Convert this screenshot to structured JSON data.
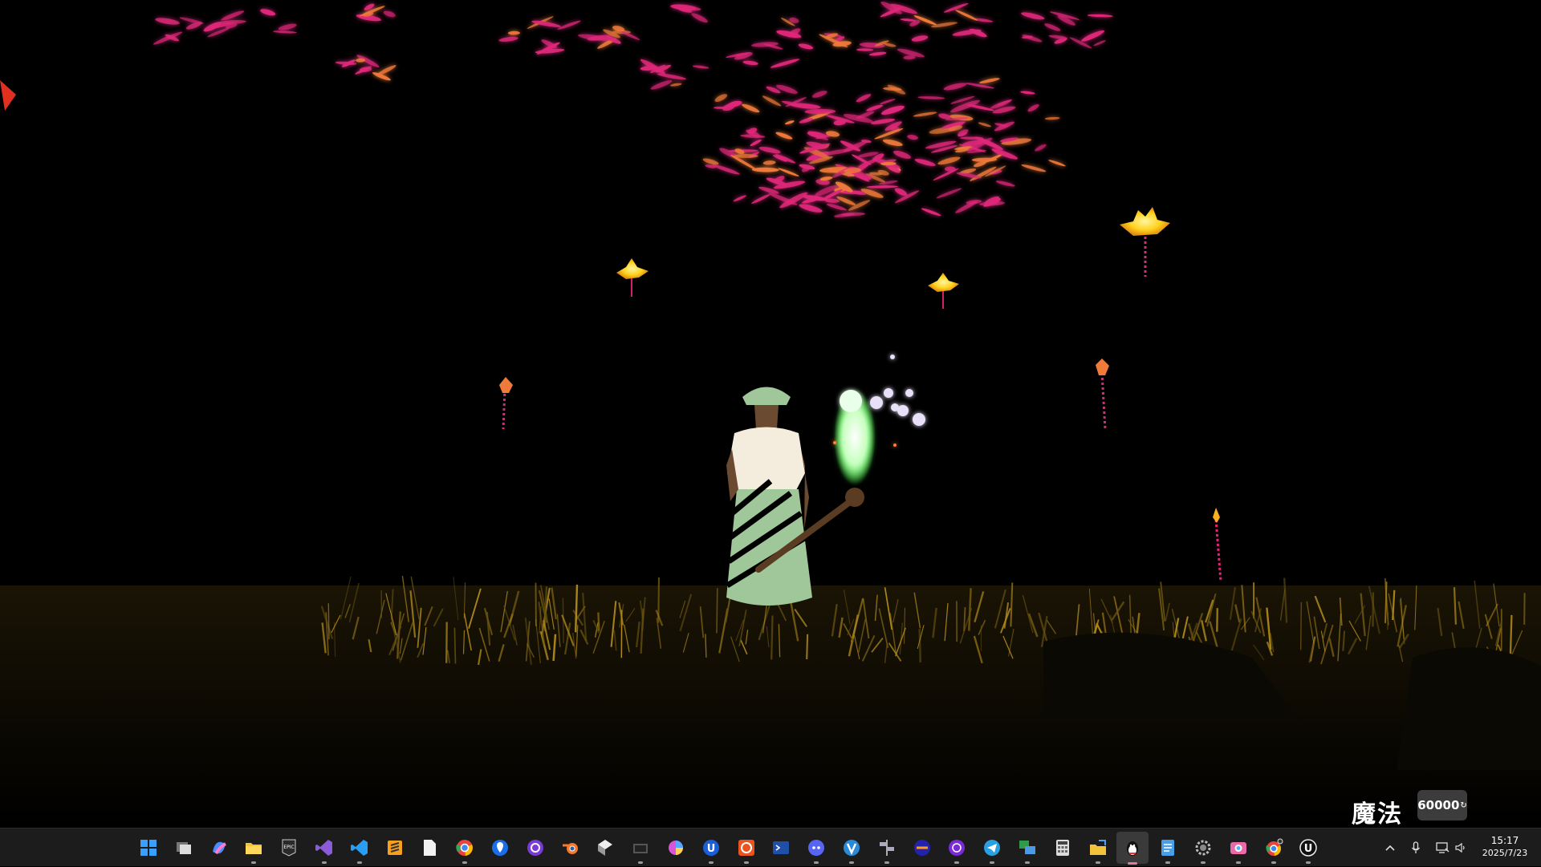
{
  "hud": {
    "magic_label": "魔法",
    "magic_value": "60000"
  },
  "colors": {
    "foliage_pink": "#e0287a",
    "foliage_orange": "#f07a3a",
    "flower_yellow": "#ffd21e",
    "grass_gold": "#b08a1a",
    "character_dress": "#f4ecdc",
    "character_skirt": "#9fc79a",
    "spirit_green": "#c8ffc0",
    "taskbar_bg": "#1c1c1c"
  },
  "taskbar": {
    "apps": [
      {
        "name": "windows-start-icon"
      },
      {
        "name": "task-view-icon"
      },
      {
        "name": "copilot-icon"
      },
      {
        "name": "file-explorer-icon"
      },
      {
        "name": "epic-games-icon"
      },
      {
        "name": "visual-studio-icon"
      },
      {
        "name": "vscode-icon"
      },
      {
        "name": "sublime-text-icon"
      },
      {
        "name": "document-icon"
      },
      {
        "name": "chrome-icon"
      },
      {
        "name": "maps-pin-icon"
      },
      {
        "name": "github-desktop-icon"
      },
      {
        "name": "blender-icon"
      },
      {
        "name": "unity-icon"
      },
      {
        "name": "media-window-icon"
      },
      {
        "name": "color-wheel-icon"
      },
      {
        "name": "unreal-blue-icon"
      },
      {
        "name": "ubuntu-icon"
      },
      {
        "name": "terminal-icon"
      },
      {
        "name": "discord-icon"
      },
      {
        "name": "vivaldi-icon"
      },
      {
        "name": "split-tool-icon"
      },
      {
        "name": "vpn-app-icon"
      },
      {
        "name": "tor-browser-icon"
      },
      {
        "name": "telegram-icon"
      },
      {
        "name": "screen-share-icon"
      },
      {
        "name": "calculator-icon"
      },
      {
        "name": "folder-move-icon"
      },
      {
        "name": "qq-penguin-icon"
      },
      {
        "name": "notepad-icon"
      },
      {
        "name": "settings-gear-icon"
      },
      {
        "name": "camera-app-icon"
      },
      {
        "name": "chrome-profile-icon"
      },
      {
        "name": "unreal-engine-icon"
      }
    ],
    "tray": {
      "time": "15:17",
      "date": "2025/7/23"
    }
  }
}
